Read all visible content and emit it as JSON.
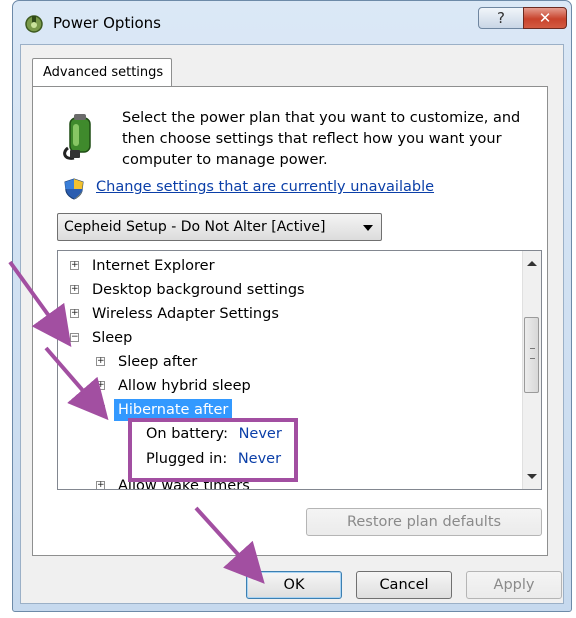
{
  "window": {
    "title": "Power Options",
    "help_label": "?",
    "close_label": "✕"
  },
  "tab": {
    "label": "Advanced settings"
  },
  "description": "Select the power plan that you want to customize, and then choose settings that reflect how you want your computer to manage power.",
  "change_link": "Change settings that are currently unavailable",
  "plan_select": {
    "selected": "Cepheid Setup - Do Not Alter [Active]"
  },
  "tree": {
    "internet_explorer": "Internet Explorer",
    "desktop_background": "Desktop background settings",
    "wireless_adapter": "Wireless Adapter Settings",
    "sleep": "Sleep",
    "sleep_after": "Sleep after",
    "allow_hybrid_sleep": "Allow hybrid sleep",
    "hibernate_after": "Hibernate after",
    "on_battery_label": "On battery:",
    "on_battery_value": "Never",
    "plugged_in_label": "Plugged in:",
    "plugged_in_value": "Never",
    "allow_wake_timers": "Allow wake timers",
    "expand_glyph": "+",
    "collapse_glyph": "−"
  },
  "buttons": {
    "restore": "Restore plan defaults",
    "ok": "OK",
    "cancel": "Cancel",
    "apply": "Apply"
  },
  "colors": {
    "annotation": "#a24fa1",
    "selection": "#3399ff",
    "link": "#0b3fa8"
  }
}
